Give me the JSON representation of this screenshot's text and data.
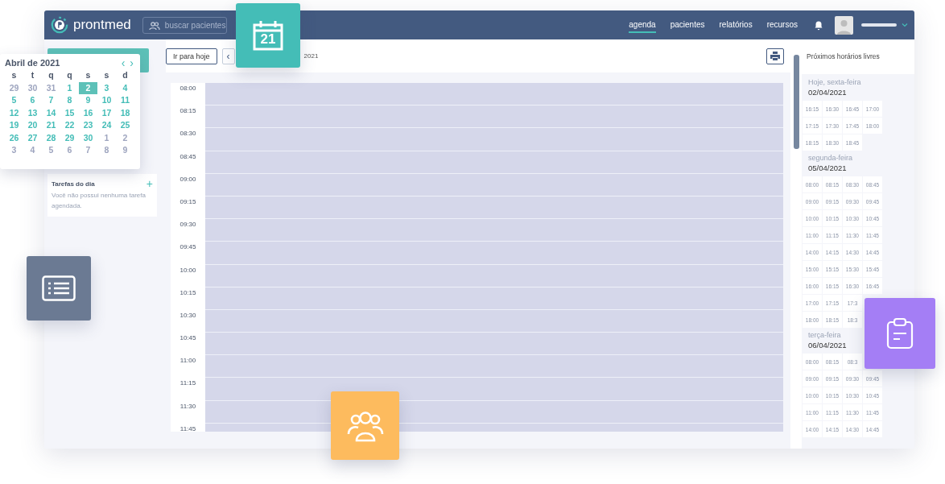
{
  "header": {
    "logo": "prontmed",
    "search": {
      "placeholder": "buscar pacientes"
    },
    "nav": [
      {
        "label": "agenda",
        "selected": true
      },
      {
        "label": "pacientes",
        "selected": false
      },
      {
        "label": "relatórios",
        "selected": false
      },
      {
        "label": "recursos",
        "selected": false
      }
    ]
  },
  "toolbar": {
    "today_button": "Ir para hoje",
    "prev_button": "‹",
    "date_label": "2021"
  },
  "calendar": {
    "title": "Abril de 2021",
    "prev": "‹",
    "next": "›",
    "weekdays": [
      "s",
      "t",
      "q",
      "q",
      "s",
      "s",
      "d"
    ],
    "days": [
      {
        "label": "29",
        "muted": true,
        "selected": false
      },
      {
        "label": "30",
        "muted": true,
        "selected": false
      },
      {
        "label": "31",
        "muted": true,
        "selected": false
      },
      {
        "label": "1",
        "muted": false,
        "selected": false
      },
      {
        "label": "2",
        "muted": false,
        "selected": true
      },
      {
        "label": "3",
        "muted": false,
        "selected": false
      },
      {
        "label": "4",
        "muted": false,
        "selected": false
      },
      {
        "label": "5",
        "muted": false,
        "selected": false
      },
      {
        "label": "6",
        "muted": false,
        "selected": false
      },
      {
        "label": "7",
        "muted": false,
        "selected": false
      },
      {
        "label": "8",
        "muted": false,
        "selected": false
      },
      {
        "label": "9",
        "muted": false,
        "selected": false
      },
      {
        "label": "10",
        "muted": false,
        "selected": false
      },
      {
        "label": "11",
        "muted": false,
        "selected": false
      },
      {
        "label": "12",
        "muted": false,
        "selected": false
      },
      {
        "label": "13",
        "muted": false,
        "selected": false
      },
      {
        "label": "14",
        "muted": false,
        "selected": false
      },
      {
        "label": "15",
        "muted": false,
        "selected": false
      },
      {
        "label": "16",
        "muted": false,
        "selected": false
      },
      {
        "label": "17",
        "muted": false,
        "selected": false
      },
      {
        "label": "18",
        "muted": false,
        "selected": false
      },
      {
        "label": "19",
        "muted": false,
        "selected": false
      },
      {
        "label": "20",
        "muted": false,
        "selected": false
      },
      {
        "label": "21",
        "muted": false,
        "selected": false
      },
      {
        "label": "22",
        "muted": false,
        "selected": false
      },
      {
        "label": "23",
        "muted": false,
        "selected": false
      },
      {
        "label": "24",
        "muted": false,
        "selected": false
      },
      {
        "label": "25",
        "muted": false,
        "selected": false
      },
      {
        "label": "26",
        "muted": false,
        "selected": false
      },
      {
        "label": "27",
        "muted": false,
        "selected": false
      },
      {
        "label": "28",
        "muted": false,
        "selected": false
      },
      {
        "label": "29",
        "muted": false,
        "selected": false
      },
      {
        "label": "30",
        "muted": false,
        "selected": false
      },
      {
        "label": "1",
        "muted": true,
        "selected": false
      },
      {
        "label": "2",
        "muted": true,
        "selected": false
      },
      {
        "label": "3",
        "muted": true,
        "selected": false
      },
      {
        "label": "4",
        "muted": true,
        "selected": false
      },
      {
        "label": "5",
        "muted": true,
        "selected": false
      },
      {
        "label": "6",
        "muted": true,
        "selected": false
      },
      {
        "label": "7",
        "muted": true,
        "selected": false
      },
      {
        "label": "8",
        "muted": true,
        "selected": false
      },
      {
        "label": "9",
        "muted": true,
        "selected": false
      }
    ]
  },
  "tasks": {
    "title": "Tarefas do dia",
    "add": "+",
    "empty": "Você não possui nenhuma tarefa agendada."
  },
  "schedule": {
    "times": [
      "08:00",
      "08:15",
      "08:30",
      "08:45",
      "09:00",
      "09:15",
      "09:30",
      "09:45",
      "10:00",
      "10:15",
      "10:30",
      "10:45",
      "11:00",
      "11:15",
      "11:30",
      "11:45"
    ]
  },
  "free_slots": {
    "title": "Próximos horários livres",
    "days": [
      {
        "label": "Hoje, sexta-feira",
        "date": "02/04/2021",
        "rows": [
          [
            "16:15",
            "16:30",
            "16:45",
            "17:00"
          ],
          [
            "17:15",
            "17:30",
            "17:45",
            "18:00"
          ],
          [
            "18:15",
            "18:30",
            "18:45"
          ]
        ]
      },
      {
        "label": "segunda-feira",
        "date": "05/04/2021",
        "rows": [
          [
            "08:00",
            "08:15",
            "08:30",
            "08:45"
          ],
          [
            "09:00",
            "09:15",
            "09:30",
            "09:45"
          ],
          [
            "10:00",
            "10:15",
            "10:30",
            "10:45"
          ],
          [
            "11:00",
            "11:15",
            "11:30",
            "11:45"
          ],
          [
            "14:00",
            "14:15",
            "14:30",
            "14:45"
          ],
          [
            "15:00",
            "15:15",
            "15:30",
            "15:45"
          ],
          [
            "16:00",
            "16:15",
            "16:30",
            "16:45"
          ],
          [
            "17:00",
            "17:15",
            "17:3"
          ],
          [
            "18:00",
            "18:15",
            "18:3"
          ]
        ]
      },
      {
        "label": "terça-feira",
        "date": "06/04/2021",
        "rows": [
          [
            "08:00",
            "08:15",
            "08:3"
          ],
          [
            "09:00",
            "09:15",
            "09:30",
            "09:45"
          ],
          [
            "10:00",
            "10:15",
            "10:30",
            "10:45"
          ],
          [
            "11:00",
            "11:15",
            "11:30",
            "11:45"
          ],
          [
            "14:00",
            "14:15",
            "14:30",
            "14:45"
          ]
        ]
      }
    ]
  },
  "calendar_tile": {
    "day": "21"
  }
}
